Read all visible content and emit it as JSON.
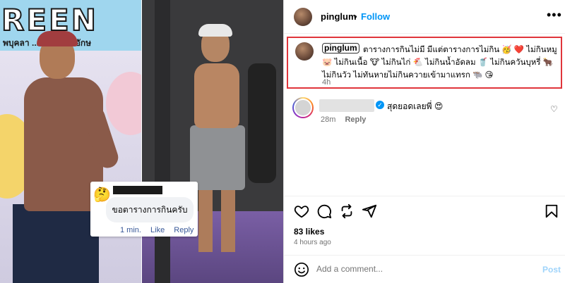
{
  "photo_left": {
    "banner_text": "REEN",
    "banner_sub": "พบุคลา ...ใหม่ \"จากอักษ",
    "comment_card": {
      "emoji": "🤔",
      "text": "ขอตารางการกินครับ",
      "time": "1 min.",
      "like": "Like",
      "reply": "Reply"
    }
  },
  "header": {
    "username": "pinglum",
    "separator": "•",
    "follow_label": "Follow",
    "more_label": "•••"
  },
  "caption": {
    "username": "pinglum",
    "text": "ตารางการกินไม่มี มีแต่ตารางการไม่กิน 🥳 ❤️ ไม่กินหมู 🐷 ไม่กินเนื้อ 🐮 ไม่กินไก่ 🐔 ไม่กินน้ำอัดลม 🥤 ไม่กินควันบุหรี่ 🐂 ไม่กินวัว ไม่ทันหายไม่กินควายเข้ามาแทรก 🐃 😘",
    "time": "4h"
  },
  "reply_comment": {
    "verified_mark": "✓",
    "text": "สุดยอดเลยพี่ 😍",
    "time": "28m",
    "reply_label": "Reply",
    "heart": "♡"
  },
  "actions": {
    "icons": [
      "heart-icon",
      "comment-icon",
      "repost-icon",
      "share-icon",
      "bookmark-icon"
    ]
  },
  "likes": "83 likes",
  "time_ago": "4 hours ago",
  "add_comment": {
    "placeholder": "Add a comment...",
    "post_label": "Post"
  },
  "colors": {
    "follow": "#0095f6",
    "highlight_border": "#e0353b",
    "post_disabled": "#9fd4fb"
  }
}
